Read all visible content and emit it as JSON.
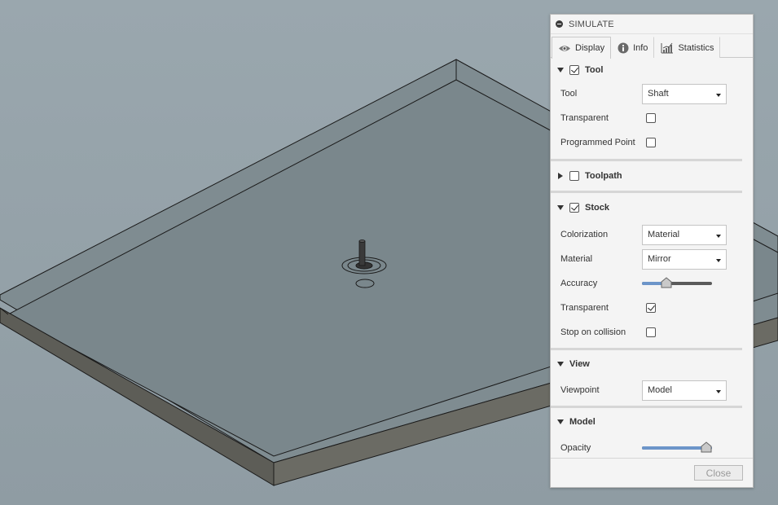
{
  "panel": {
    "title": "SIMULATE",
    "close_label": "Close"
  },
  "tabs": [
    {
      "label": "Display",
      "icon": "eye-icon",
      "active": true
    },
    {
      "label": "Info",
      "icon": "info-icon",
      "active": false
    },
    {
      "label": "Statistics",
      "icon": "statistics-chart-icon",
      "active": false
    }
  ],
  "sections": {
    "tool": {
      "title": "Tool",
      "enabled": true,
      "expanded": true,
      "tool_label": "Tool",
      "tool_value": "Shaft",
      "transparent_label": "Transparent",
      "transparent": false,
      "programmed_point_label": "Programmed Point",
      "programmed_point": false
    },
    "toolpath": {
      "title": "Toolpath",
      "enabled": false,
      "expanded": false
    },
    "stock": {
      "title": "Stock",
      "enabled": true,
      "expanded": true,
      "colorization_label": "Colorization",
      "colorization_value": "Material",
      "material_label": "Material",
      "material_value": "Mirror",
      "accuracy_label": "Accuracy",
      "accuracy_level": 0.35,
      "transparent_label": "Transparent",
      "transparent": true,
      "stop_on_collision_label": "Stop on collision",
      "stop_on_collision": false
    },
    "view": {
      "title": "View",
      "expanded": true,
      "viewpoint_label": "Viewpoint",
      "viewpoint_value": "Model"
    },
    "model": {
      "title": "Model",
      "expanded": true,
      "opacity_label": "Opacity",
      "opacity_level": 1.0
    }
  },
  "colors": {
    "slider_fill": "#6c95c9",
    "slider_track": "#5a5a5a",
    "viewport_bg": "#97a4ab"
  }
}
